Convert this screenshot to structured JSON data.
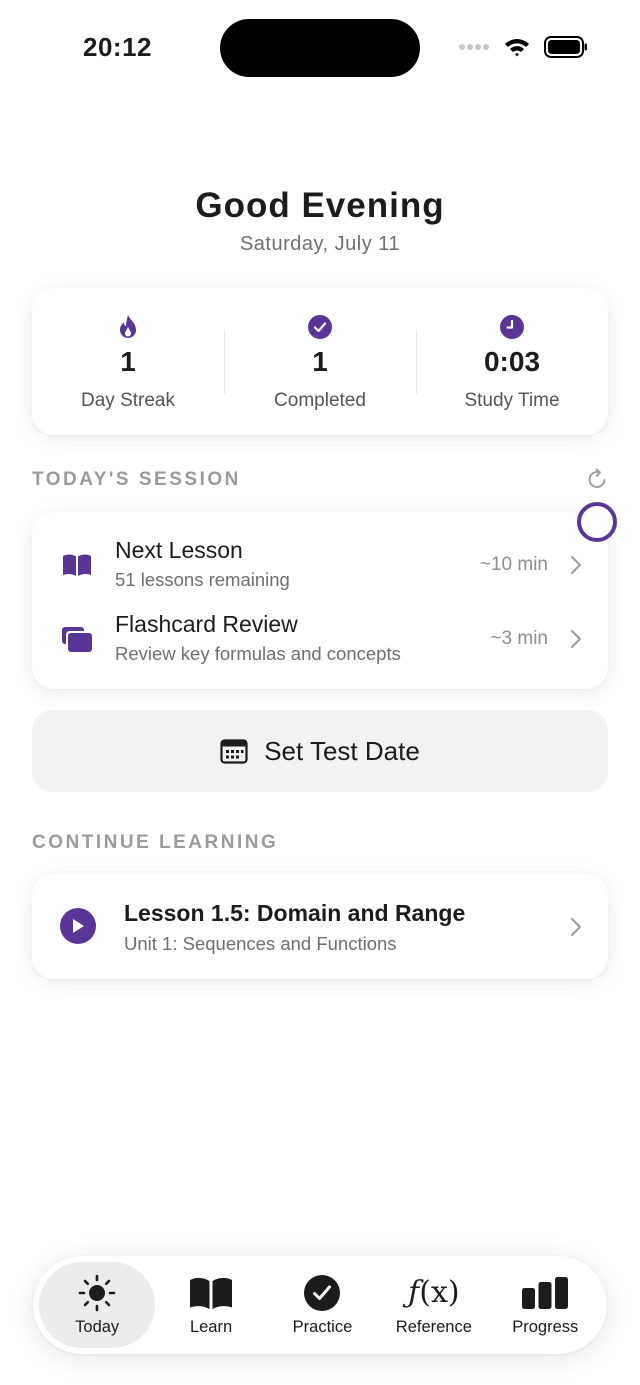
{
  "status_bar": {
    "time": "20:12"
  },
  "header": {
    "greeting": "Good Evening",
    "date": "Saturday, July 11"
  },
  "stats": [
    {
      "value": "1",
      "label": "Day Streak",
      "icon": "flame-icon"
    },
    {
      "value": "1",
      "label": "Completed",
      "icon": "checkmark-circle-icon"
    },
    {
      "value": "0:03",
      "label": "Study Time",
      "icon": "clock-icon"
    }
  ],
  "session": {
    "header": "TODAY'S SESSION",
    "items": [
      {
        "title": "Next Lesson",
        "subtitle": "51 lessons remaining",
        "time": "~10 min",
        "icon": "book-icon"
      },
      {
        "title": "Flashcard Review",
        "subtitle": "Review key formulas and concepts",
        "time": "~3 min",
        "icon": "cards-icon"
      }
    ]
  },
  "test_date": {
    "label": "Set Test Date",
    "icon": "calendar-icon"
  },
  "continue": {
    "header": "CONTINUE LEARNING",
    "title": "Lesson 1.5: Domain and Range",
    "subtitle": "Unit 1: Sequences and Functions",
    "icon": "play-icon"
  },
  "tabs": [
    {
      "label": "Today",
      "icon": "sun-icon",
      "active": true
    },
    {
      "label": "Learn",
      "icon": "book-icon"
    },
    {
      "label": "Practice",
      "icon": "checkmark-circle-icon"
    },
    {
      "label": "Reference",
      "icon": "function-icon",
      "glyph_f": "ƒ",
      "glyph_x": "(x)"
    },
    {
      "label": "Progress",
      "icon": "bar-chart-icon"
    }
  ],
  "colors": {
    "accent": "#5b3596",
    "text": "#1c1c1e",
    "secondary": "#6e6e73",
    "section_header": "#9a9a9f",
    "button_bg": "#f2f2f4"
  }
}
